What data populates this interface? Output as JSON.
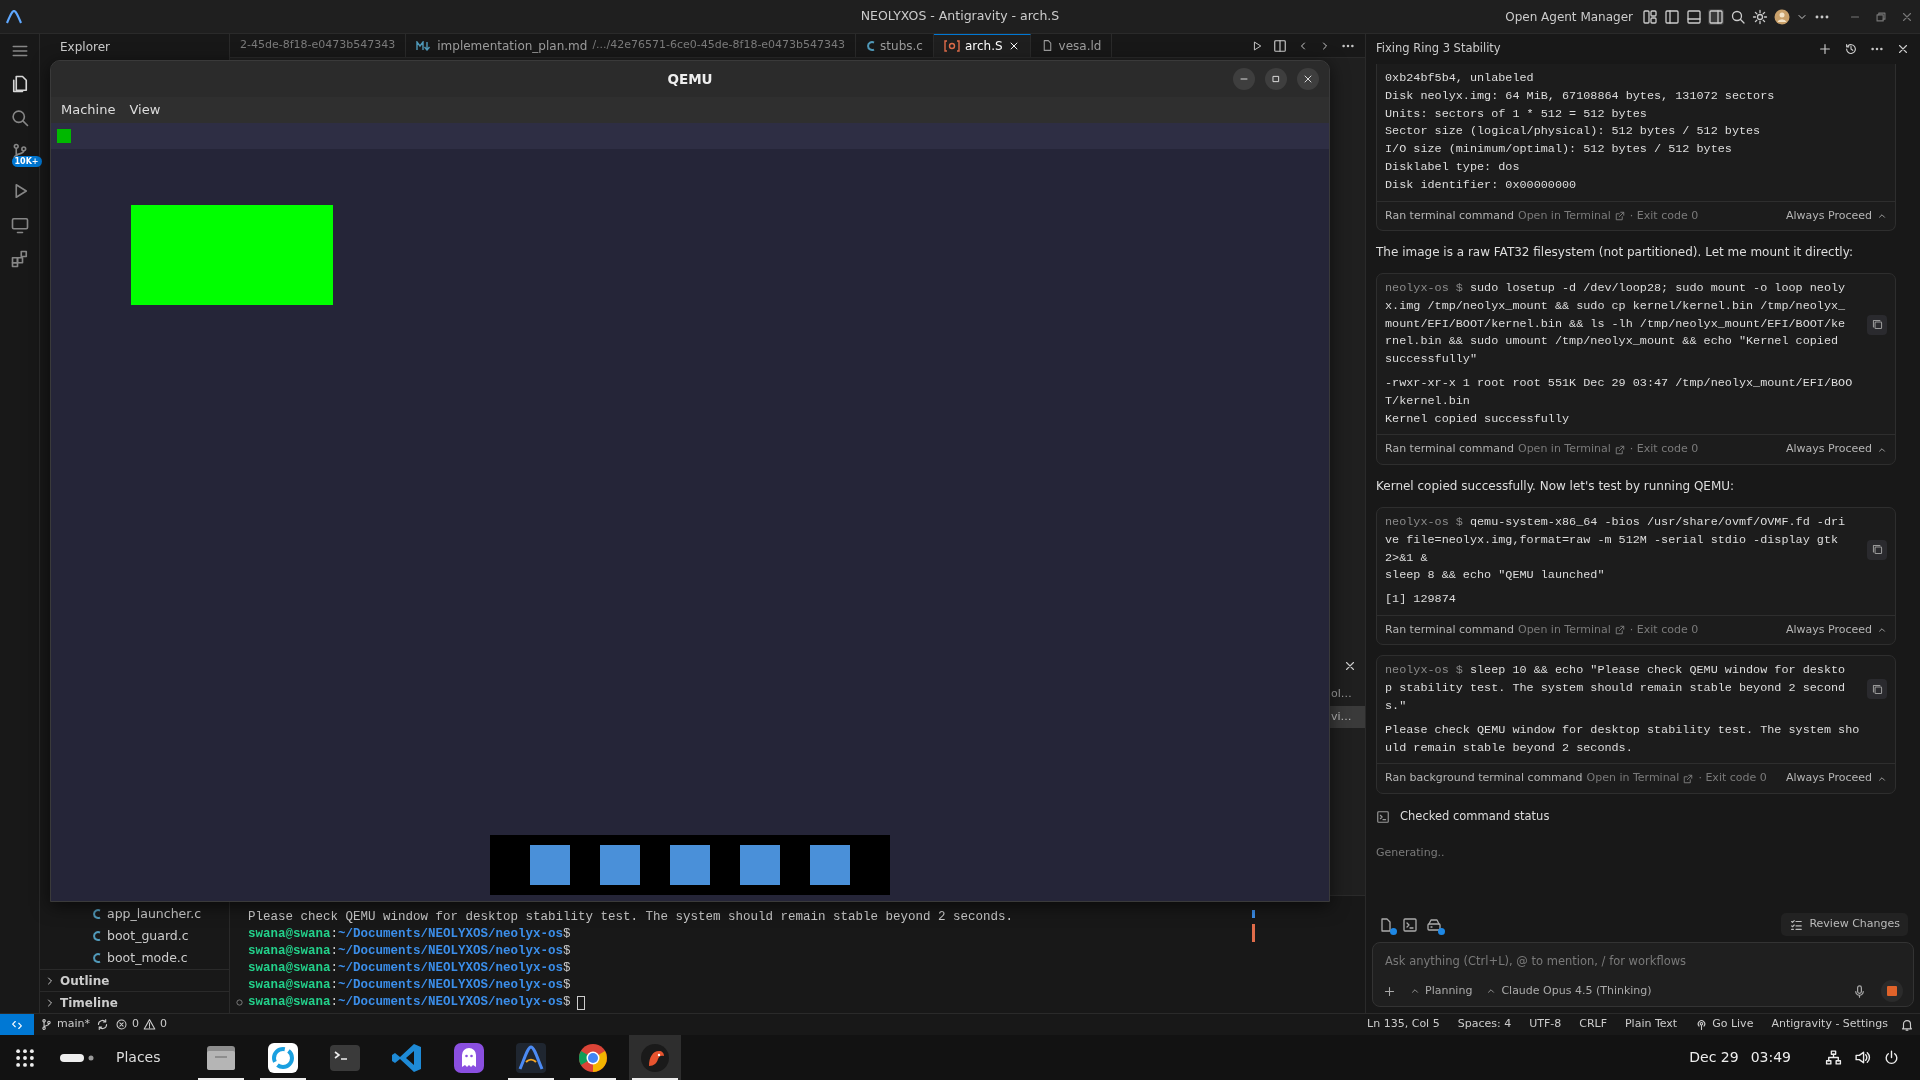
{
  "title_bar": {
    "title": "NEOLYXOS - Antigravity - arch.S",
    "agent_manager": "Open Agent Manager"
  },
  "activity_bar": {
    "badge": "10K+"
  },
  "explorer": {
    "title": "Explorer",
    "files": [
      "app_launcher.c",
      "boot_guard.c",
      "boot_mode.c"
    ],
    "sections": [
      {
        "label": "Outline",
        "expanded": false
      },
      {
        "label": "Timeline",
        "expanded": false
      }
    ]
  },
  "editor_tabs": [
    {
      "kind": "cut",
      "description": "2-45de-8f18-e0473b547343",
      "selected": false
    },
    {
      "kind": "md",
      "label": "implementation_plan.md",
      "description": "/.../42e76571-6ce0-45de-8f18-e0473b547343",
      "selected": false
    },
    {
      "kind": "c",
      "label": "stubs.c",
      "selected": false
    },
    {
      "kind": "asm",
      "label": "arch.S",
      "selected": true
    },
    {
      "kind": "ld",
      "label": "vesa.ld",
      "selected": false
    }
  ],
  "side_list": [
    {
      "label": "ol…",
      "selected": false
    },
    {
      "label": "vi…",
      "selected": true
    }
  ],
  "terminal": {
    "lines": [
      {
        "kind": "output",
        "text": "Please check QEMU window for desktop stability test. The system should remain stable beyond 2 seconds."
      },
      {
        "kind": "prompt",
        "user": "swana@swana",
        "sep": ":",
        "path": "~/Documents/NEOLYXOS/neolyx-os",
        "symbol": "$",
        "cursor": false
      },
      {
        "kind": "prompt",
        "user": "swana@swana",
        "sep": ":",
        "path": "~/Documents/NEOLYXOS/neolyx-os",
        "symbol": "$",
        "cursor": false
      },
      {
        "kind": "prompt",
        "user": "swana@swana",
        "sep": ":",
        "path": "~/Documents/NEOLYXOS/neolyx-os",
        "symbol": "$",
        "cursor": false
      },
      {
        "kind": "prompt",
        "user": "swana@swana",
        "sep": ":",
        "path": "~/Documents/NEOLYXOS/neolyx-os",
        "symbol": "$",
        "cursor": false
      },
      {
        "kind": "prompt",
        "user": "swana@swana",
        "sep": ":",
        "path": "~/Documents/NEOLYXOS/neolyx-os",
        "symbol": "$",
        "cursor": true
      }
    ]
  },
  "qemu": {
    "title": "QEMU",
    "menu": [
      "Machine",
      "View"
    ]
  },
  "agent_panel": {
    "title": "Fixing Ring 3 Stability",
    "blocks": [
      {
        "kind": "command",
        "output": [
          "0xb24bf5b4, unlabeled",
          "Disk neolyx.img: 64 MiB, 67108864 bytes, 131072 sectors",
          "Units: sectors of 1 * 512 = 512 bytes",
          "Sector size (logical/physical): 512 bytes / 512 bytes",
          "I/O size (minimum/optimal): 512 bytes / 512 bytes",
          "Disklabel type: dos",
          "Disk identifier: 0x00000000"
        ],
        "footer": {
          "label": "Ran terminal command",
          "open": "Open in Terminal",
          "exit": "· Exit code 0",
          "proceed": "Always Proceed"
        }
      },
      {
        "kind": "text",
        "text": "The image is a raw FAT32 filesystem (not partitioned). Let me mount it directly:"
      },
      {
        "kind": "command",
        "prompt": "neolyx-os $",
        "command": "sudo losetup -d /dev/loop28; sudo mount -o loop neolyx.img /tmp/neolyx_mount && sudo cp kernel/kernel.bin /tmp/neolyx_mount/EFI/BOOT/kernel.bin && ls -lh /tmp/neolyx_mount/EFI/BOOT/kernel.bin && sudo umount /tmp/neolyx_mount && echo \"Kernel copied successfully\"",
        "output": [
          "-rwxr-xr-x 1 root root 551K Dec 29 03:47 /tmp/neolyx_mount/EFI/BOOT/kernel.bin",
          "Kernel copied successfully"
        ],
        "footer": {
          "label": "Ran terminal command",
          "open": "Open in Terminal",
          "exit": "· Exit code 0",
          "proceed": "Always Proceed"
        }
      },
      {
        "kind": "text",
        "text": "Kernel copied successfully. Now let's test by running QEMU:"
      },
      {
        "kind": "command",
        "prompt": "neolyx-os $",
        "command": "qemu-system-x86_64 -bios /usr/share/ovmf/OVMF.fd -drive file=neolyx.img,format=raw -m 512M -serial stdio -display gtk 2>&1 &\nsleep 8 && echo \"QEMU launched\"",
        "output": [
          "[1] 129874"
        ],
        "footer": {
          "label": "Ran terminal command",
          "open": "Open in Terminal",
          "exit": "· Exit code 0",
          "proceed": "Always Proceed"
        }
      },
      {
        "kind": "command",
        "prompt": "neolyx-os $",
        "command": "sleep 10 && echo \"Please check QEMU window for desktop stability test. The system should remain stable beyond 2 seconds.\"",
        "output": [
          "Please check QEMU window for desktop stability test. The system should remain stable beyond 2 seconds."
        ],
        "footer": {
          "label": "Ran background terminal command",
          "open": "Open in Terminal",
          "exit": "· Exit code 0",
          "proceed": "Always Proceed"
        }
      },
      {
        "kind": "status",
        "text": "Checked command status"
      },
      {
        "kind": "generating",
        "text": "Generating.."
      }
    ],
    "review": "Review Changes",
    "input": {
      "placeholder": "Ask anything (Ctrl+L), @ to mention, / for workflows"
    },
    "mode": "Planning",
    "model": "Claude Opus 4.5 (Thinking)"
  },
  "status_bar": {
    "branch": "main*",
    "errors": "0",
    "warnings": "0",
    "right": [
      "Ln 135, Col 5",
      "Spaces: 4",
      "UTF-8",
      "CRLF",
      "Plain Text",
      "Go Live",
      "Antigravity - Settings"
    ]
  },
  "taskbar": {
    "places": "Places",
    "apps": [
      {
        "kind": "files",
        "running": true,
        "selected": false
      },
      {
        "kind": "ring",
        "running": true,
        "selected": false
      },
      {
        "kind": "terminal",
        "running": false,
        "selected": false
      },
      {
        "kind": "code",
        "running": false,
        "selected": false
      },
      {
        "kind": "ghost",
        "running": false,
        "selected": false
      },
      {
        "kind": "arch",
        "running": true,
        "selected": false
      },
      {
        "kind": "browser",
        "running": true,
        "selected": false
      },
      {
        "kind": "bird",
        "running": true,
        "selected": true
      }
    ],
    "date": "Dec 29",
    "time": "03:49"
  }
}
